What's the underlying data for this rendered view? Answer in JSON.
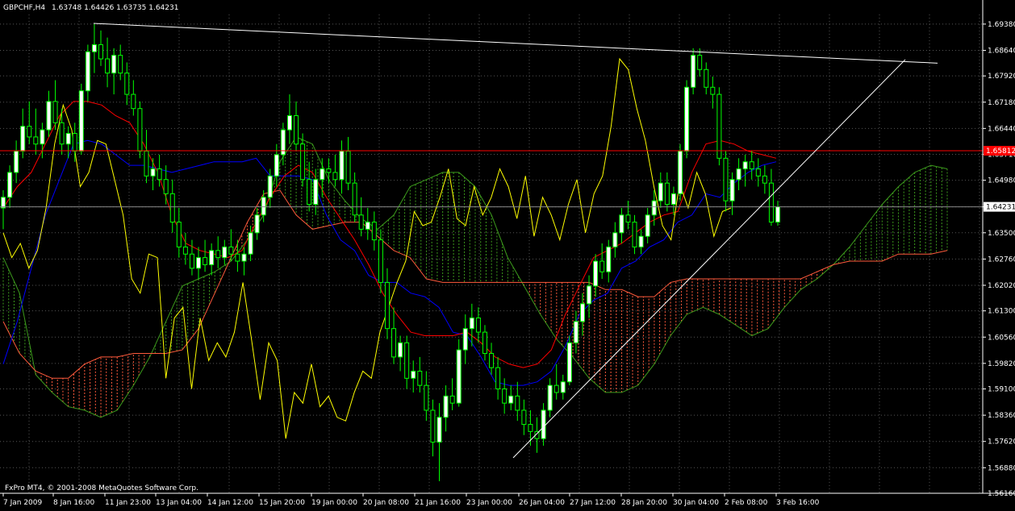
{
  "window": {
    "symbol": "GBPCHF,H4",
    "ohlc": "1.63748 1.64426 1.63735 1.64231",
    "copyright": "FxPro MT4, © 2001-2008 MetaQuotes Software Corp."
  },
  "colors": {
    "background": "#000000",
    "grid": "#555555",
    "bull_candle": "#ffffff",
    "bear_candle": "#000000",
    "candle_wick": "#00ff00",
    "tenkan": "#ff0000",
    "kijun": "#0000ff",
    "chikou": "#ffff00",
    "kumo_up": "#3c9a1c",
    "kumo_down": "#ff5a3c",
    "trendline": "#ffffff",
    "hline": "#ff0000",
    "price_tag_bg": "#ffffff",
    "price_tag_text": "#000000"
  },
  "chart_data": {
    "type": "candlestick",
    "symbol": "GBPCHF",
    "timeframe": "H4",
    "ylim": [
      1.5616,
      1.6965
    ],
    "y_ticks": [
      "1.69380",
      "1.68640",
      "1.67920",
      "1.67180",
      "1.66440",
      "1.65710",
      "1.64980",
      "1.64231",
      "1.63500",
      "1.62760",
      "1.62020",
      "1.61300",
      "1.60560",
      "1.59820",
      "1.59100",
      "1.58360",
      "1.57620",
      "1.56880",
      "1.56160"
    ],
    "x_ticks": [
      "7 Jan 2009",
      "8 Jan 16:00",
      "11 Jan 23:00",
      "13 Jan 04:00",
      "14 Jan 12:00",
      "15 Jan 20:00",
      "19 Jan 00:00",
      "20 Jan 08:00",
      "21 Jan 16:00",
      "23 Jan 00:00",
      "26 Jan 04:00",
      "27 Jan 12:00",
      "28 Jan 20:00",
      "30 Jan 04:00",
      "2 Feb 08:00",
      "3 Feb 16:00"
    ],
    "current_price": "1.64231",
    "hline_price": "1.65812",
    "candles": [
      [
        1.642,
        1.647,
        1.636,
        1.645
      ],
      [
        1.645,
        1.654,
        1.642,
        1.652
      ],
      [
        1.652,
        1.661,
        1.649,
        1.658
      ],
      [
        1.658,
        1.67,
        1.656,
        1.665
      ],
      [
        1.665,
        1.672,
        1.66,
        1.662
      ],
      [
        1.662,
        1.67,
        1.657,
        1.66
      ],
      [
        1.66,
        1.666,
        1.656,
        1.664
      ],
      [
        1.664,
        1.675,
        1.662,
        1.672
      ],
      [
        1.672,
        1.678,
        1.664,
        1.666
      ],
      [
        1.666,
        1.67,
        1.657,
        1.66
      ],
      [
        1.66,
        1.665,
        1.656,
        1.663
      ],
      [
        1.663,
        1.666,
        1.655,
        1.658
      ],
      [
        1.658,
        1.677,
        1.657,
        1.675
      ],
      [
        1.675,
        1.688,
        1.672,
        1.686
      ],
      [
        1.686,
        1.6938,
        1.68,
        1.688
      ],
      [
        1.688,
        1.692,
        1.682,
        1.684
      ],
      [
        1.684,
        1.69,
        1.676,
        1.68
      ],
      [
        1.68,
        1.687,
        1.674,
        1.685
      ],
      [
        1.685,
        1.688,
        1.678,
        1.68
      ],
      [
        1.68,
        1.683,
        1.671,
        1.674
      ],
      [
        1.674,
        1.678,
        1.668,
        1.67
      ],
      [
        1.67,
        1.672,
        1.656,
        1.658
      ],
      [
        1.658,
        1.664,
        1.649,
        1.651
      ],
      [
        1.651,
        1.656,
        1.647,
        1.653
      ],
      [
        1.653,
        1.657,
        1.648,
        1.65
      ],
      [
        1.65,
        1.654,
        1.643,
        1.646
      ],
      [
        1.646,
        1.65,
        1.635,
        1.638
      ],
      [
        1.638,
        1.642,
        1.628,
        1.631
      ],
      [
        1.631,
        1.635,
        1.626,
        1.629
      ],
      [
        1.629,
        1.633,
        1.623,
        1.625
      ],
      [
        1.625,
        1.631,
        1.622,
        1.628
      ],
      [
        1.628,
        1.633,
        1.624,
        1.626
      ],
      [
        1.626,
        1.632,
        1.623,
        1.63
      ],
      [
        1.63,
        1.634,
        1.625,
        1.628
      ],
      [
        1.628,
        1.633,
        1.626,
        1.631
      ],
      [
        1.631,
        1.636,
        1.627,
        1.629
      ],
      [
        1.629,
        1.633,
        1.624,
        1.627
      ],
      [
        1.627,
        1.631,
        1.623,
        1.629
      ],
      [
        1.629,
        1.637,
        1.627,
        1.635
      ],
      [
        1.635,
        1.642,
        1.633,
        1.64
      ],
      [
        1.64,
        1.647,
        1.638,
        1.645
      ],
      [
        1.645,
        1.653,
        1.642,
        1.651
      ],
      [
        1.651,
        1.66,
        1.648,
        1.657
      ],
      [
        1.657,
        1.666,
        1.654,
        1.664
      ],
      [
        1.664,
        1.674,
        1.66,
        1.668
      ],
      [
        1.668,
        1.672,
        1.658,
        1.66
      ],
      [
        1.66,
        1.663,
        1.648,
        1.65
      ],
      [
        1.65,
        1.655,
        1.641,
        1.643
      ],
      [
        1.643,
        1.653,
        1.64,
        1.65
      ],
      [
        1.65,
        1.656,
        1.645,
        1.653
      ],
      [
        1.653,
        1.656,
        1.649,
        1.652
      ],
      [
        1.652,
        1.657,
        1.648,
        1.65
      ],
      [
        1.65,
        1.661,
        1.646,
        1.658
      ],
      [
        1.658,
        1.662,
        1.647,
        1.649
      ],
      [
        1.649,
        1.652,
        1.638,
        1.64
      ],
      [
        1.64,
        1.645,
        1.634,
        1.636
      ],
      [
        1.636,
        1.642,
        1.633,
        1.638
      ],
      [
        1.638,
        1.641,
        1.63,
        1.633
      ],
      [
        1.633,
        1.636,
        1.618,
        1.621
      ],
      [
        1.621,
        1.625,
        1.605,
        1.608
      ],
      [
        1.608,
        1.614,
        1.598,
        1.6
      ],
      [
        1.6,
        1.606,
        1.596,
        1.604
      ],
      [
        1.604,
        1.606,
        1.591,
        1.594
      ],
      [
        1.594,
        1.599,
        1.59,
        1.596
      ],
      [
        1.596,
        1.6,
        1.59,
        1.592
      ],
      [
        1.592,
        1.596,
        1.582,
        1.585
      ],
      [
        1.585,
        1.588,
        1.572,
        1.576
      ],
      [
        1.576,
        1.587,
        1.565,
        1.583
      ],
      [
        1.583,
        1.592,
        1.579,
        1.589
      ],
      [
        1.589,
        1.594,
        1.585,
        1.587
      ],
      [
        1.587,
        1.605,
        1.586,
        1.602
      ],
      [
        1.602,
        1.612,
        1.598,
        1.608
      ],
      [
        1.608,
        1.615,
        1.603,
        1.611
      ],
      [
        1.611,
        1.614,
        1.604,
        1.607
      ],
      [
        1.607,
        1.609,
        1.599,
        1.601
      ],
      [
        1.601,
        1.604,
        1.595,
        1.597
      ],
      [
        1.597,
        1.6,
        1.588,
        1.591
      ],
      [
        1.591,
        1.594,
        1.584,
        1.587
      ],
      [
        1.587,
        1.592,
        1.585,
        1.589
      ],
      [
        1.589,
        1.593,
        1.582,
        1.585
      ],
      [
        1.585,
        1.588,
        1.578,
        1.581
      ],
      [
        1.581,
        1.585,
        1.575,
        1.579
      ],
      [
        1.579,
        1.583,
        1.573,
        1.577
      ],
      [
        1.577,
        1.587,
        1.575,
        1.585
      ],
      [
        1.585,
        1.594,
        1.583,
        1.592
      ],
      [
        1.592,
        1.598,
        1.588,
        1.59
      ],
      [
        1.59,
        1.595,
        1.588,
        1.593
      ],
      [
        1.593,
        1.606,
        1.592,
        1.604
      ],
      [
        1.604,
        1.613,
        1.601,
        1.61
      ],
      [
        1.61,
        1.618,
        1.606,
        1.615
      ],
      [
        1.615,
        1.623,
        1.611,
        1.62
      ],
      [
        1.62,
        1.629,
        1.617,
        1.627
      ],
      [
        1.627,
        1.632,
        1.622,
        1.624
      ],
      [
        1.624,
        1.633,
        1.621,
        1.631
      ],
      [
        1.631,
        1.638,
        1.628,
        1.635
      ],
      [
        1.635,
        1.642,
        1.632,
        1.64
      ],
      [
        1.64,
        1.644,
        1.636,
        1.638
      ],
      [
        1.638,
        1.64,
        1.629,
        1.631
      ],
      [
        1.631,
        1.636,
        1.629,
        1.634
      ],
      [
        1.634,
        1.642,
        1.632,
        1.64
      ],
      [
        1.64,
        1.647,
        1.637,
        1.644
      ],
      [
        1.644,
        1.652,
        1.642,
        1.649
      ],
      [
        1.649,
        1.652,
        1.641,
        1.643
      ],
      [
        1.643,
        1.648,
        1.64,
        1.646
      ],
      [
        1.646,
        1.66,
        1.644,
        1.658
      ],
      [
        1.658,
        1.678,
        1.656,
        1.676
      ],
      [
        1.676,
        1.687,
        1.674,
        1.685
      ],
      [
        1.685,
        1.687,
        1.679,
        1.681
      ],
      [
        1.681,
        1.683,
        1.674,
        1.676
      ],
      [
        1.676,
        1.679,
        1.67,
        1.674
      ],
      [
        1.674,
        1.676,
        1.654,
        1.656
      ],
      [
        1.656,
        1.658,
        1.641,
        1.644
      ],
      [
        1.644,
        1.652,
        1.64,
        1.65
      ],
      [
        1.65,
        1.656,
        1.647,
        1.653
      ],
      [
        1.653,
        1.657,
        1.648,
        1.655
      ],
      [
        1.655,
        1.658,
        1.65,
        1.653
      ],
      [
        1.653,
        1.656,
        1.648,
        1.651
      ],
      [
        1.651,
        1.654,
        1.646,
        1.649
      ],
      [
        1.649,
        1.653,
        1.637,
        1.638
      ],
      [
        1.638,
        1.644,
        1.637,
        1.6423
      ]
    ],
    "tenkan": [
      1.642,
      1.648,
      1.652,
      1.66,
      1.668,
      1.672,
      1.672,
      1.671,
      1.668,
      1.666,
      1.66,
      1.652,
      1.64,
      1.632,
      1.63,
      1.629,
      1.628,
      1.63,
      1.638,
      1.645,
      1.651,
      1.654,
      1.652,
      1.645,
      1.639,
      1.633,
      1.626,
      1.618,
      1.612,
      1.607,
      1.606,
      1.606,
      1.606,
      1.607,
      1.604,
      1.6,
      1.598,
      1.597,
      1.598,
      1.602,
      1.612,
      1.62,
      1.628,
      1.63,
      1.632,
      1.635,
      1.638,
      1.64,
      1.641,
      1.652,
      1.66,
      1.661,
      1.66,
      1.658,
      1.657,
      1.656
    ],
    "kijun": [
      1.598,
      1.61,
      1.625,
      1.64,
      1.65,
      1.66,
      1.661,
      1.66,
      1.657,
      1.654,
      1.654,
      1.653,
      1.652,
      1.653,
      1.654,
      1.655,
      1.655,
      1.655,
      1.656,
      1.651,
      1.651,
      1.651,
      1.65,
      1.64,
      1.633,
      1.63,
      1.623,
      1.621,
      1.621,
      1.618,
      1.617,
      1.614,
      1.607,
      1.606,
      1.6,
      1.593,
      1.592,
      1.592,
      1.593,
      1.596,
      1.603,
      1.612,
      1.616,
      1.618,
      1.625,
      1.627,
      1.631,
      1.633,
      1.638,
      1.64,
      1.646,
      1.645,
      1.649,
      1.652,
      1.654,
      1.655
    ],
    "chikou": [
      1.635,
      1.628,
      1.632,
      1.625,
      1.63,
      1.642,
      1.66,
      1.671,
      1.664,
      1.648,
      1.652,
      1.661,
      1.66,
      1.65,
      1.64,
      1.622,
      1.618,
      1.629,
      1.628,
      1.594,
      1.611,
      1.614,
      1.591,
      1.611,
      1.599,
      1.604,
      1.6,
      1.607,
      1.621,
      1.605,
      1.588,
      1.604,
      1.599,
      1.577,
      1.59,
      1.587,
      1.598,
      1.586,
      1.589,
      1.583,
      1.582,
      1.59,
      1.596,
      1.594,
      1.607,
      1.614,
      1.621,
      1.627,
      1.641,
      1.637,
      1.638,
      1.645,
      1.653,
      1.639,
      1.637,
      1.648,
      1.64,
      1.645,
      1.653,
      1.648,
      1.639,
      1.651,
      1.634,
      1.645,
      1.64,
      1.633,
      1.643,
      1.65,
      1.635,
      1.646,
      1.651,
      1.665,
      1.684,
      1.681,
      1.67,
      1.661,
      1.648,
      1.637,
      1.633,
      1.649,
      1.642,
      1.652,
      1.646,
      1.634,
      1.641,
      1.642
    ],
    "senkou_a": [
      1.628,
      1.618,
      1.595,
      1.59,
      1.586,
      1.585,
      1.583,
      1.585,
      1.592,
      1.6,
      1.61,
      1.62,
      1.622,
      1.624,
      1.627,
      1.633,
      1.64,
      1.655,
      1.662,
      1.66,
      1.65,
      1.644,
      1.639,
      1.636,
      1.64,
      1.648,
      1.65,
      1.652,
      1.652,
      1.648,
      1.64,
      1.628,
      1.62,
      1.612,
      1.605,
      1.6,
      1.594,
      1.59,
      1.59,
      1.592,
      1.598,
      1.606,
      1.612,
      1.614,
      1.612,
      1.609,
      1.606,
      1.608,
      1.614,
      1.619,
      1.622,
      1.626,
      1.631,
      1.637,
      1.643,
      1.648,
      1.652,
      1.654,
      1.653
    ],
    "senkou_b": [
      1.61,
      1.601,
      1.596,
      1.594,
      1.594,
      1.598,
      1.6,
      1.6,
      1.601,
      1.601,
      1.601,
      1.602,
      1.608,
      1.618,
      1.628,
      1.638,
      1.646,
      1.647,
      1.64,
      1.636,
      1.637,
      1.638,
      1.638,
      1.634,
      1.63,
      1.628,
      1.622,
      1.621,
      1.621,
      1.621,
      1.621,
      1.621,
      1.621,
      1.621,
      1.621,
      1.621,
      1.621,
      1.619,
      1.619,
      1.617,
      1.617,
      1.621,
      1.622,
      1.622,
      1.622,
      1.622,
      1.622,
      1.622,
      1.622,
      1.622,
      1.624,
      1.626,
      1.627,
      1.627,
      1.627,
      1.629,
      1.629,
      1.629,
      1.63
    ]
  }
}
